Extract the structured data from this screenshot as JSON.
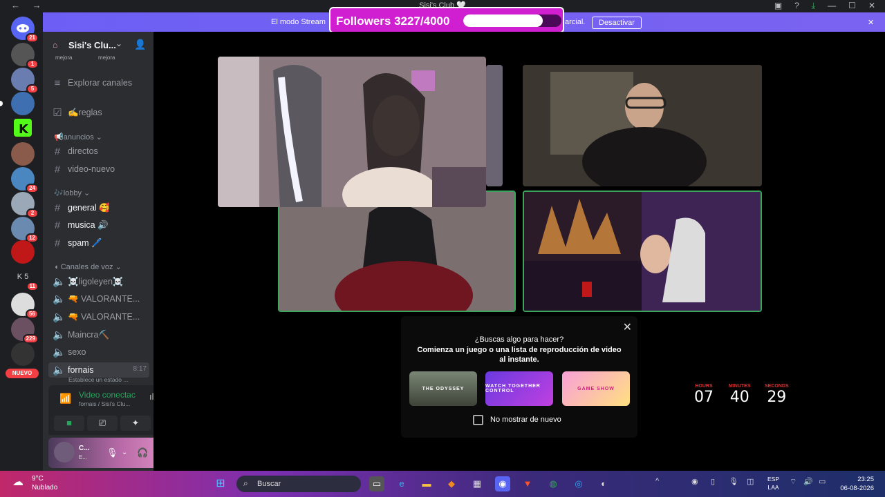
{
  "window": {
    "title": "Sisi's Club 🤍",
    "nav": [
      "←",
      "→"
    ]
  },
  "stream_banner": {
    "message": "El modo Stream",
    "message_tail": "arcial.",
    "button": "Desactivar",
    "close": "×"
  },
  "followers_overlay": {
    "label": "Followers 3227/4000",
    "current": 3227,
    "goal": 4000,
    "progress": 0.807
  },
  "server_badges": [
    "21",
    "1",
    "5",
    "24",
    "2",
    "12",
    "11",
    "56",
    "229"
  ],
  "nuevo_label": "NUEVO",
  "server": {
    "name": "Sisi's Clu...",
    "boost_labels": [
      "mejora",
      "mejora"
    ],
    "explore": "Explorar canales",
    "channels": [
      {
        "name": "✍️reglas",
        "type": "rules"
      },
      {
        "name": "📢anuncios",
        "type": "category"
      },
      {
        "name": "directos",
        "type": "text"
      },
      {
        "name": "video-nuevo",
        "type": "text"
      },
      {
        "name": "🎶lobby",
        "type": "category"
      },
      {
        "name": "general 🥰",
        "type": "text"
      },
      {
        "name": "musica 🔊",
        "type": "text"
      },
      {
        "name": "spam 🖊️",
        "type": "text"
      },
      {
        "name": "Canales de voz",
        "type": "category"
      },
      {
        "name": "☠️ligoleyen☠️",
        "type": "voice"
      },
      {
        "name": "🔫 VALORANTE...",
        "type": "voice"
      },
      {
        "name": "🔫 VALORANTE...",
        "type": "voice"
      },
      {
        "name": "Maincra⛏️",
        "type": "voice"
      },
      {
        "name": "sexo",
        "type": "voice"
      },
      {
        "name": "fornais",
        "type": "voice",
        "time": "8:17"
      }
    ],
    "status_sub": "Establece un estado ..."
  },
  "voice_panel": {
    "title": "Video conectac",
    "subtitle": "fornais / Sisi's Clu..."
  },
  "user_panel": {
    "name": "C...",
    "status": "E..."
  },
  "activity_popup": {
    "question": "¿Buscas algo para hacer?",
    "description": "Comienza un juego o una lista de reproducción de video al instante.",
    "activities": [
      "THE ODYSSEY",
      "WATCH TOGETHER CONTROL",
      "GAME SHOW"
    ],
    "checkbox_label": "No mostrar de nuevo"
  },
  "countdown": [
    {
      "unit": "HOURS",
      "value": "07"
    },
    {
      "unit": "MINUTES",
      "value": "40"
    },
    {
      "unit": "SECONDS",
      "value": "29"
    }
  ],
  "taskbar": {
    "weather_temp": "9°C",
    "weather_desc": "Nublado",
    "search_placeholder": "Buscar",
    "lang_top": "ESP",
    "lang_bottom": "LAA",
    "time": "23:25",
    "date": "06-08-2026"
  }
}
